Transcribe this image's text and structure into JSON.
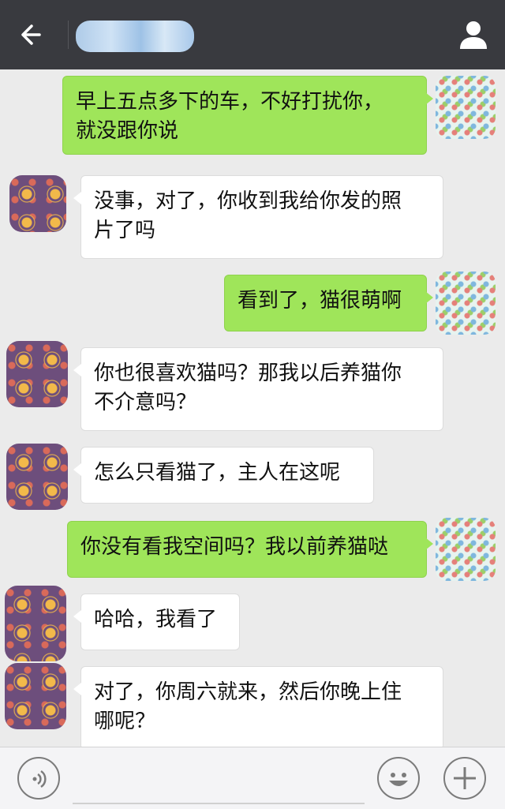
{
  "header": {
    "contact_name": "██████"
  },
  "messages": [
    {
      "from": "me",
      "text": "早上五点多下的车，不好打扰你，\n就没跟你说"
    },
    {
      "from": "other",
      "text": "没事，对了，你收到我给你发的照\n片了吗"
    },
    {
      "from": "me",
      "text": "看到了，猫很萌啊"
    },
    {
      "from": "other",
      "text": "你也很喜欢猫吗？那我以后养猫你\n不介意吗？"
    },
    {
      "from": "other",
      "text": "怎么只看猫了，主人在这呢"
    },
    {
      "from": "me",
      "text": "你没有看我空间吗？我以前养猫哒"
    },
    {
      "from": "other",
      "text": "哈哈，我看了"
    },
    {
      "from": "other",
      "text": "对了，你周六就来，然后你晚上住\n哪呢？"
    }
  ],
  "icons": {
    "back": "arrow-left-icon",
    "profile": "person-icon",
    "voice": "voice-icon",
    "emoji": "smiley-icon",
    "more": "plus-icon"
  },
  "colors": {
    "header_bg": "#393a3f",
    "chat_bg": "#ebebeb",
    "my_bubble": "#9fe55a",
    "their_bubble": "#ffffff"
  }
}
